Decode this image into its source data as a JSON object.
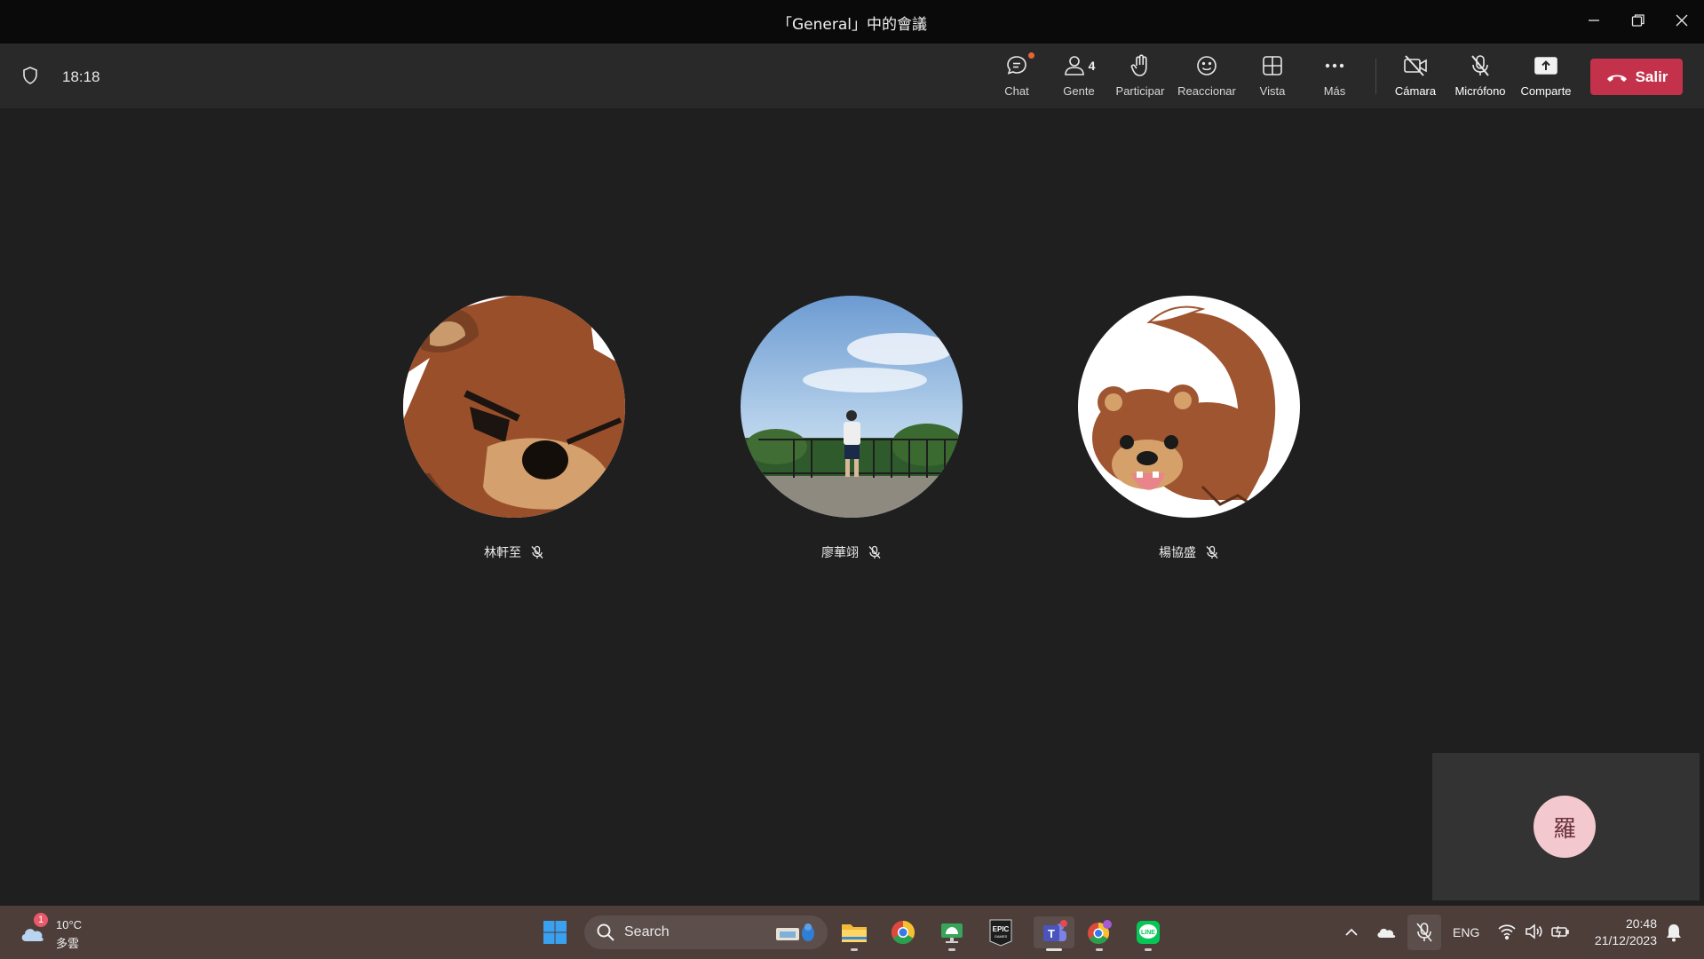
{
  "window": {
    "title": "「General」中的會議"
  },
  "toolbar": {
    "timer": "18:18",
    "buttons": {
      "chat": "Chat",
      "people": "Gente",
      "people_count": "4",
      "raise": "Participar",
      "react": "Reaccionar",
      "view": "Vista",
      "more": "Más",
      "camera": "Cámara",
      "mic": "Micrófono",
      "share": "Comparte"
    },
    "leave": "Salir",
    "leave_color": "#c4314b"
  },
  "participants": [
    {
      "name": "林軒至",
      "muted": true
    },
    {
      "name": "廖華翊",
      "muted": true
    },
    {
      "name": "楊協盛",
      "muted": true
    }
  ],
  "self_view": {
    "initial": "羅"
  },
  "taskbar": {
    "weather": {
      "temp": "10°C",
      "desc": "多雲",
      "badge": "1"
    },
    "search_label": "Search",
    "tray": {
      "language": "ENG",
      "time": "20:48",
      "date": "21/12/2023"
    },
    "apps": [
      "start-icon",
      "file-explorer-icon",
      "chrome-icon",
      "remote-desktop-icon",
      "epic-games-icon",
      "teams-icon",
      "chrome-profile-icon",
      "line-icon"
    ]
  }
}
